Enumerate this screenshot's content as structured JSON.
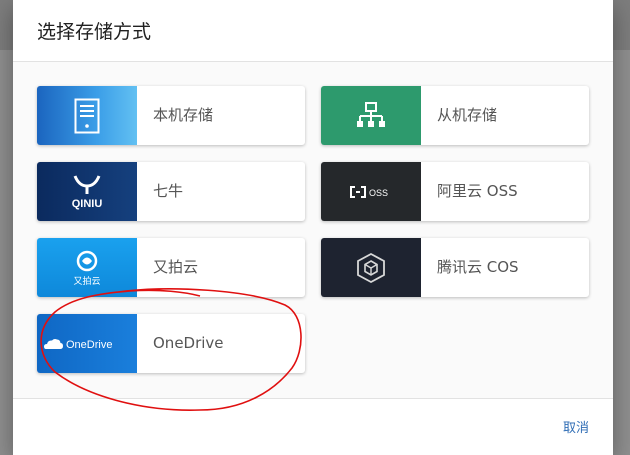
{
  "dialog": {
    "title": "选择存储方式",
    "cancel_label": "取消"
  },
  "storage_options": [
    {
      "label": "本机存储",
      "icon": "server-icon"
    },
    {
      "label": "从机存储",
      "icon": "network-tree-icon"
    },
    {
      "label": "七牛",
      "icon": "qiniu-logo",
      "logo_text": "QINIU"
    },
    {
      "label": "阿里云 OSS",
      "icon": "aliyun-logo",
      "logo_text": "OSS"
    },
    {
      "label": "又拍云",
      "icon": "upyun-logo",
      "logo_text": "又拍云"
    },
    {
      "label": "腾讯云 COS",
      "icon": "tencent-cloud-logo"
    },
    {
      "label": "OneDrive",
      "icon": "onedrive-logo",
      "logo_text": "OneDrive"
    }
  ],
  "colors": {
    "title": "#212121",
    "label": "#555555",
    "cancel": "#2f6db5",
    "annotation": "#e01010"
  }
}
